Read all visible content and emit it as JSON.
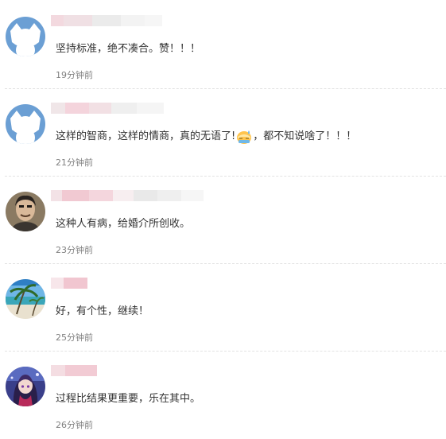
{
  "comments": [
    {
      "text": "坚持标准，绝不凑合。赞！！！",
      "time": "19分钟前",
      "avatar": "default-avatar-icon"
    },
    {
      "text_before": "这样的智商，这样的情商，真的无语了!",
      "emoji": "sweat-emoji-icon",
      "text_after": "，都不知说啥了！！！",
      "time": "21分钟前",
      "avatar": "default-avatar-icon"
    },
    {
      "text": "这种人有病，给婚介所创收。",
      "time": "23分钟前",
      "avatar": "user-photo"
    },
    {
      "text": "好，有个性，继续！",
      "time": "25分钟前",
      "avatar": "beach-photo"
    },
    {
      "text": "过程比结果更重要，乐在其中。",
      "time": "26分钟前",
      "avatar": "anime-photo"
    }
  ],
  "colors": {
    "avatar_blue": "#6b9fd4",
    "text": "#333333",
    "time": "#808080"
  }
}
